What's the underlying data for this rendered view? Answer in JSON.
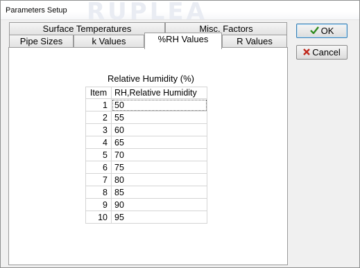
{
  "window": {
    "title": "Parameters Setup",
    "watermark": "RUPLEA"
  },
  "tabs": {
    "row1": [
      {
        "label": "Surface Temperatures"
      },
      {
        "label": "Misc. Factors"
      }
    ],
    "row2": [
      {
        "label": "Pipe Sizes"
      },
      {
        "label": "k Values"
      },
      {
        "label": "%RH Values",
        "active": true
      },
      {
        "label": "R Values"
      }
    ]
  },
  "grid": {
    "title": "Relative Humidity (%)",
    "headers": {
      "item": "Item",
      "value": "RH,Relative Humidity"
    },
    "rows": [
      {
        "item": "1",
        "value": "50"
      },
      {
        "item": "2",
        "value": "55"
      },
      {
        "item": "3",
        "value": "60"
      },
      {
        "item": "4",
        "value": "65"
      },
      {
        "item": "5",
        "value": "70"
      },
      {
        "item": "6",
        "value": "75"
      },
      {
        "item": "7",
        "value": "80"
      },
      {
        "item": "8",
        "value": "85"
      },
      {
        "item": "9",
        "value": "90"
      },
      {
        "item": "10",
        "value": "95"
      }
    ]
  },
  "buttons": {
    "ok": "OK",
    "cancel": "Cancel"
  },
  "colors": {
    "ok_check": "#2e8b1f",
    "cancel_x": "#c0281c"
  }
}
